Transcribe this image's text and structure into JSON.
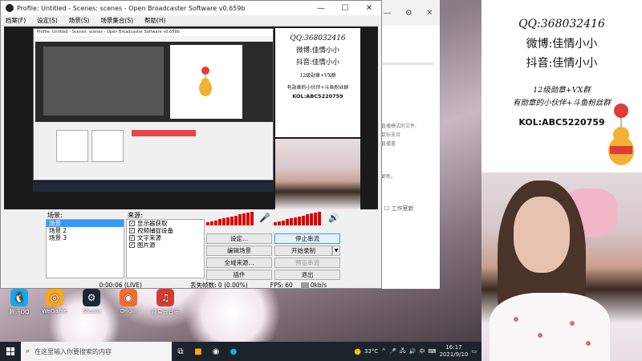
{
  "obs": {
    "title": "Profile: Untitled - Scenes: scenes - Open Broadcaster Software v0.659b",
    "menu": [
      "档案(F)",
      "设定(S)",
      "场景(S)",
      "场景集合(S)",
      "帮助(H)"
    ],
    "nested_title": "Profile: Untitled - Scenes: scenes - Open Broadcaster Software v0.659b",
    "scenes_label": "场景:",
    "scenes": [
      "场景",
      "场景 2",
      "场景 3"
    ],
    "sources_label": "来源:",
    "sources": [
      "显示器获取",
      "视频捕捉设备",
      "文字来源",
      "图片源"
    ],
    "buttons": {
      "settings": "设定...",
      "stop_stream": "停止串流",
      "edit_scene": "编辑场景",
      "start_record": "开始录制",
      "global_sources": "全域来源...",
      "preview_stream": "预览串流",
      "plugins": "插件",
      "exit": "退出"
    },
    "status": {
      "time": "0:00:06 (LIVE)",
      "dropped": "丢失帧数: 0 (0.00%)",
      "fps": "FPS: 60",
      "bitrate": "0kb/s"
    }
  },
  "overlay": {
    "qq": "QQ:368032416",
    "weibo": "微博:佳情小小",
    "douyin": "抖音:佳情小小",
    "badge": "12级勋章+VX群",
    "fans": "有勋章的小伙伴+斗鱼粉丝群",
    "kol": "KOL:ABC5220759"
  },
  "desktop_icons": [
    {
      "label": "腾讯QQ",
      "icon": "qq-icon",
      "color": "#1aa7ec"
    },
    {
      "label": "WeGame",
      "icon": "wegame-icon",
      "color": "#f6a623"
    },
    {
      "label": "Steam",
      "icon": "steam-icon",
      "color": "#1b2838"
    },
    {
      "label": "Origin",
      "icon": "origin-icon",
      "color": "#f56c2d"
    },
    {
      "label": "网易云音乐",
      "icon": "netease-music-icon",
      "color": "#d43c33"
    }
  ],
  "bg_window": {
    "text1": "直播模式的文件,",
    "text2": "鼠标支持",
    "text3": "直播重",
    "text4": "更新。",
    "checkbox": "工作室新"
  },
  "taskbar": {
    "search_placeholder": "在这里输入你要搜索的内容",
    "weather": "33°C",
    "time": "16:17",
    "date": "2021/9/10",
    "ime": "中"
  },
  "colors": {
    "accent": "#3399ff",
    "meter": "#dd0000",
    "taskbar": "#1d232b"
  }
}
